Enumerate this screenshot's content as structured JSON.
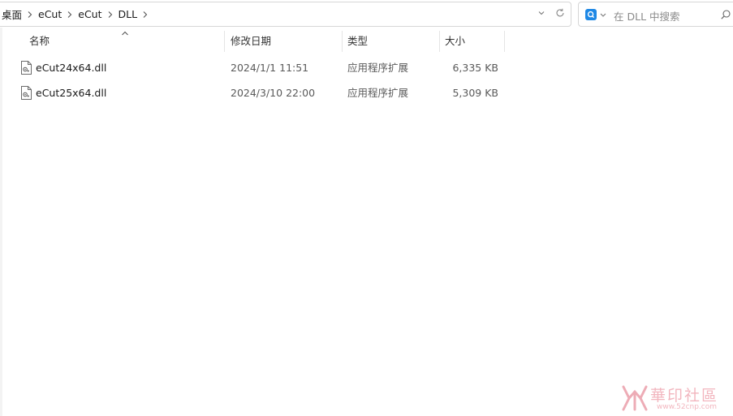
{
  "breadcrumb": [
    "桌面",
    "eCut",
    "eCut",
    "DLL"
  ],
  "search": {
    "placeholder": "在 DLL 中搜索"
  },
  "columns": {
    "name": "名称",
    "date": "修改日期",
    "type": "类型",
    "size": "大小"
  },
  "files": [
    {
      "name": "eCut24x64.dll",
      "date": "2024/1/1 11:51",
      "type": "应用程序扩展",
      "size": "6,335 KB"
    },
    {
      "name": "eCut25x64.dll",
      "date": "2024/3/10 22:00",
      "type": "应用程序扩展",
      "size": "5,309 KB"
    }
  ],
  "watermark": {
    "text": "華印社區",
    "url": "www.52cnp.com"
  },
  "icons": [
    "chevron-right-icon",
    "chevron-down-icon",
    "refresh-icon",
    "search-engine-icon",
    "search-icon",
    "sort-up-icon",
    "dll-file-icon"
  ]
}
